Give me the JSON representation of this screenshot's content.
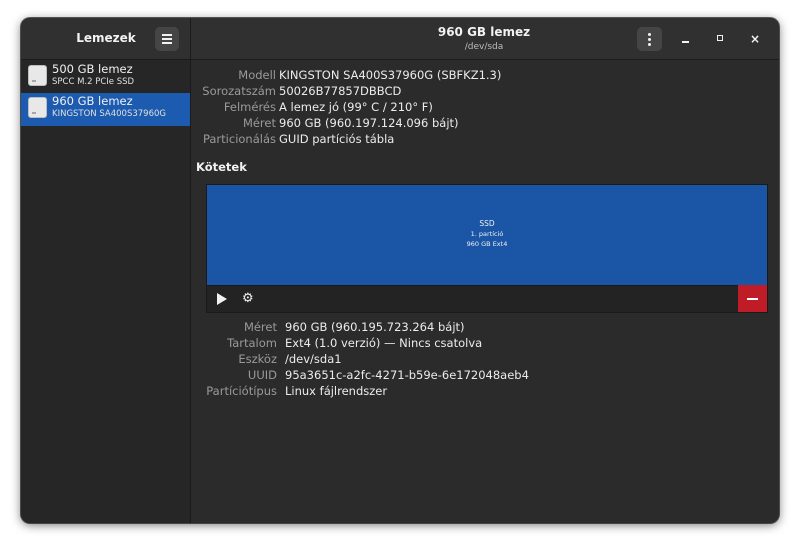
{
  "sidebar": {
    "title": "Lemezek",
    "disks": [
      {
        "name": "500 GB lemez",
        "model": "SPCC M.2 PCIe SSD",
        "selected": false
      },
      {
        "name": "960 GB lemez",
        "model": "KINGSTON SA400S37960G",
        "selected": true
      }
    ]
  },
  "header": {
    "title": "960 GB lemez",
    "subtitle": "/dev/sda",
    "window_controls": [
      "minimize-icon",
      "maximize-icon",
      "close-icon"
    ],
    "close_glyph": "×"
  },
  "drive_info": {
    "model_label": "Modell",
    "model_value": "KINGSTON SA400S37960G (SBFKZ1.3)",
    "serial_label": "Sorozatszám",
    "serial_value": "50026B77857DBBCD",
    "assessment_label": "Felmérés",
    "assessment_value": "A lemez jó (99° C / 210° F)",
    "size_label": "Méret",
    "size_value": "960 GB (960.197.124.096 bájt)",
    "partitioning_label": "Particionálás",
    "partitioning_value": "GUID partíciós tábla"
  },
  "volumes": {
    "section_title": "Kötetek",
    "partition_name": "SSD",
    "partition_number": "1. partíció",
    "partition_size": "960 GB Ext4",
    "toolbar_icons": [
      "play-icon",
      "gears-icon",
      "minus-icon"
    ]
  },
  "volume_info": {
    "size_label": "Méret",
    "size_value": "960 GB (960.195.723.264 bájt)",
    "contents_label": "Tartalom",
    "contents_value": "Ext4 (1.0 verzió) — Nincs csatolva",
    "device_label": "Eszköz",
    "device_value": "/dev/sda1",
    "uuid_label": "UUID",
    "uuid_value": "95a3651c-a2fc-4271-b59e-6e172048aeb4",
    "ptype_label": "Partíciótípus",
    "ptype_value": "Linux fájlrendszer"
  },
  "colors": {
    "accent": "#1c5bb0",
    "partition": "#1b55a6",
    "destructive": "#c01c28"
  }
}
